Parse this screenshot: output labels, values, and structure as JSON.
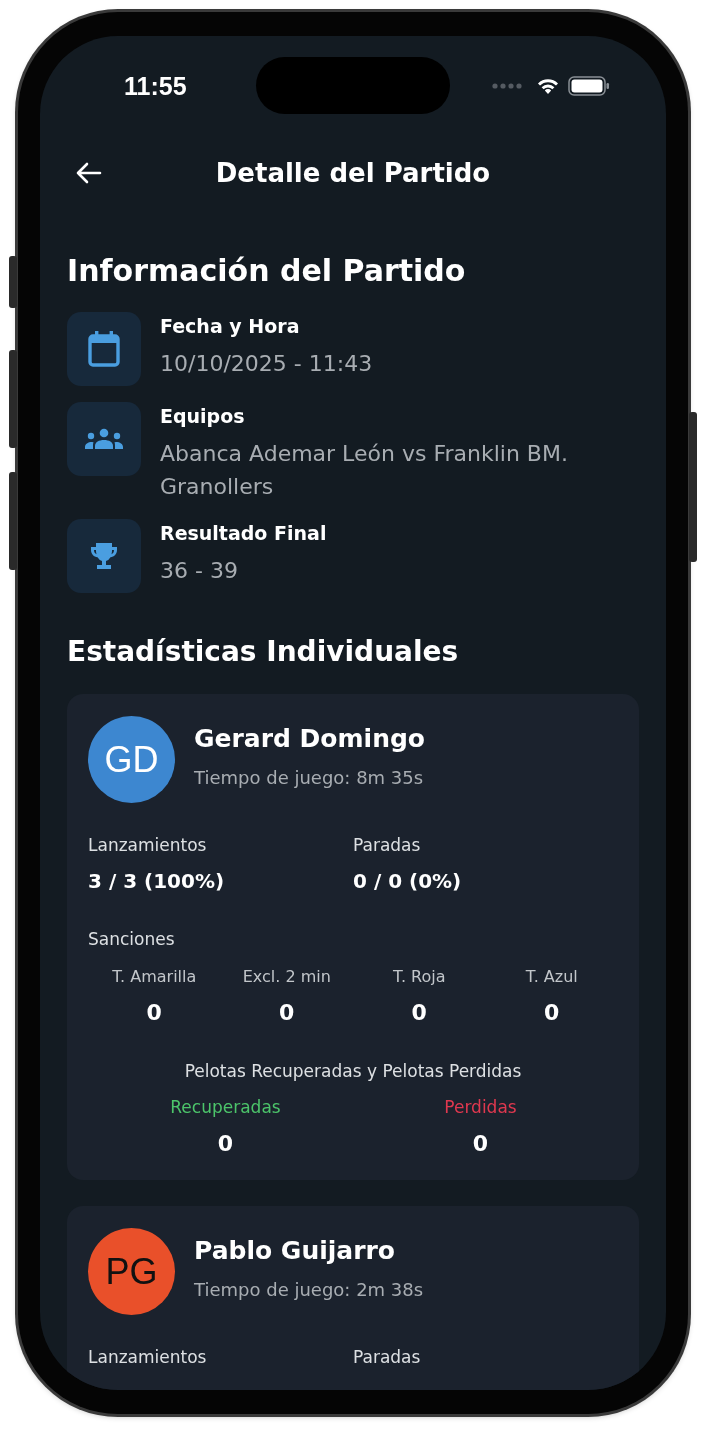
{
  "status_bar": {
    "time": "11:55"
  },
  "header": {
    "title": "Detalle del Partido"
  },
  "match_info": {
    "title": "Información del Partido",
    "items": [
      {
        "label": "Fecha y Hora",
        "value": "10/10/2025 - 11:43"
      },
      {
        "label": "Equipos",
        "value": "Abanca Ademar León vs Franklin BM. Granollers"
      },
      {
        "label": "Resultado Final",
        "value": "36 - 39"
      }
    ]
  },
  "individual_stats": {
    "title": "Estadísticas Individuales",
    "players": [
      {
        "initials": "GD",
        "color": "#3d87d0",
        "dark_initials": false,
        "name": "Gerard Domingo",
        "play_time": "Tiempo de juego: 8m 35s",
        "stats": [
          {
            "label": "Lanzamientos",
            "value": "3 / 3 (100%)"
          },
          {
            "label": "Paradas",
            "value": "0 / 0 (0%)"
          }
        ],
        "sanctions": {
          "title": "Sanciones",
          "items": [
            {
              "label": "T. Amarilla",
              "value": "0"
            },
            {
              "label": "Excl. 2 min",
              "value": "0"
            },
            {
              "label": "T. Roja",
              "value": "0"
            },
            {
              "label": "T. Azul",
              "value": "0"
            }
          ]
        },
        "balls": {
          "title": "Pelotas Recuperadas y Pelotas Perdidas",
          "items": [
            {
              "label": "Recuperadas",
              "value": "0",
              "color": "#4cc46a"
            },
            {
              "label": "Perdidas",
              "value": "0",
              "color": "#e0384f"
            }
          ]
        }
      },
      {
        "initials": "PG",
        "color": "#e9502a",
        "dark_initials": true,
        "name": "Pablo Guijarro",
        "play_time": "Tiempo de juego: 2m 38s",
        "stats": [
          {
            "label": "Lanzamientos"
          },
          {
            "label": "Paradas"
          }
        ]
      }
    ]
  }
}
